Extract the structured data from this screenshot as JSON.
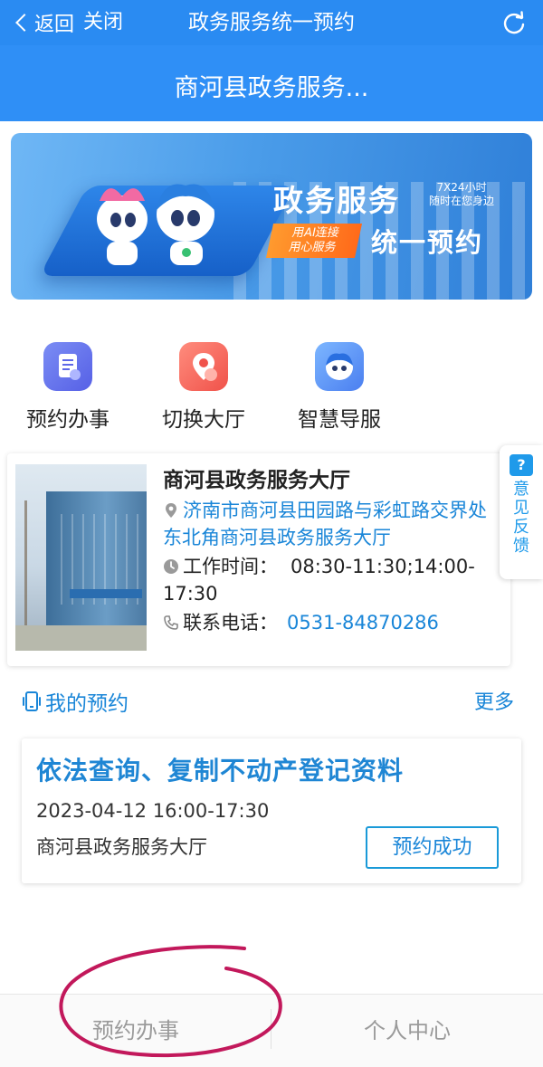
{
  "navbar": {
    "back_label": "返回",
    "close_label": "关闭",
    "title": "政务服务统一预约"
  },
  "subheader": {
    "title": "商河县政务服务..."
  },
  "banner": {
    "main_title": "政务服务",
    "tagline_line1": "7X24小时",
    "tagline_line2": "随时在您身边",
    "tag_line1": "用AI连接",
    "tag_line2": "用心服务",
    "sub_title": "统一预约"
  },
  "actions": [
    {
      "label": "预约办事",
      "icon": "appointment-clipboard-icon"
    },
    {
      "label": "切换大厅",
      "icon": "switch-hall-location-icon"
    },
    {
      "label": "智慧导服",
      "icon": "smart-guide-mascot-icon"
    }
  ],
  "hall": {
    "name": "商河县政务服务大厅",
    "address": "济南市商河县田园路与彩虹路交界处东北角商河县政务服务大厅",
    "hours_label": "工作时间：",
    "hours_value": "08:30-11:30;14:00-17:30",
    "phone_label": "联系电话：",
    "phone_value": "0531-84870286"
  },
  "feedback": {
    "label": "意见反馈"
  },
  "my_appointments": {
    "title": "我的预约",
    "more_label": "更多",
    "items": [
      {
        "title": "依法查询、复制不动产登记资料",
        "time": "2023-04-12 16:00-17:30",
        "hall": "商河县政务服务大厅",
        "status": "预约成功"
      }
    ]
  },
  "tabbar": {
    "tabs": [
      {
        "label": "预约办事"
      },
      {
        "label": "个人中心"
      }
    ]
  },
  "colors": {
    "primary_blue": "#2a8bf2",
    "link_blue": "#1a86d8",
    "annotation_magenta": "#c2185b"
  }
}
